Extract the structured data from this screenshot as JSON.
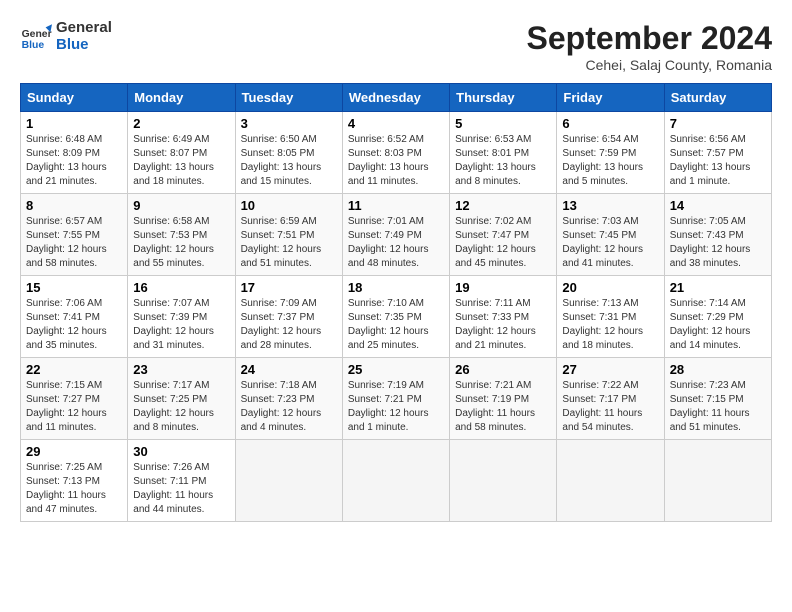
{
  "header": {
    "logo_line1": "General",
    "logo_line2": "Blue",
    "month_title": "September 2024",
    "location": "Cehei, Salaj County, Romania"
  },
  "weekdays": [
    "Sunday",
    "Monday",
    "Tuesday",
    "Wednesday",
    "Thursday",
    "Friday",
    "Saturday"
  ],
  "days": [
    {
      "num": "",
      "info": ""
    },
    {
      "num": "",
      "info": ""
    },
    {
      "num": "",
      "info": ""
    },
    {
      "num": "",
      "info": ""
    },
    {
      "num": "",
      "info": ""
    },
    {
      "num": "",
      "info": ""
    },
    {
      "num": "",
      "info": ""
    },
    {
      "num": "1",
      "info": "Sunrise: 6:48 AM\nSunset: 8:09 PM\nDaylight: 13 hours\nand 21 minutes."
    },
    {
      "num": "2",
      "info": "Sunrise: 6:49 AM\nSunset: 8:07 PM\nDaylight: 13 hours\nand 18 minutes."
    },
    {
      "num": "3",
      "info": "Sunrise: 6:50 AM\nSunset: 8:05 PM\nDaylight: 13 hours\nand 15 minutes."
    },
    {
      "num": "4",
      "info": "Sunrise: 6:52 AM\nSunset: 8:03 PM\nDaylight: 13 hours\nand 11 minutes."
    },
    {
      "num": "5",
      "info": "Sunrise: 6:53 AM\nSunset: 8:01 PM\nDaylight: 13 hours\nand 8 minutes."
    },
    {
      "num": "6",
      "info": "Sunrise: 6:54 AM\nSunset: 7:59 PM\nDaylight: 13 hours\nand 5 minutes."
    },
    {
      "num": "7",
      "info": "Sunrise: 6:56 AM\nSunset: 7:57 PM\nDaylight: 13 hours\nand 1 minute."
    },
    {
      "num": "8",
      "info": "Sunrise: 6:57 AM\nSunset: 7:55 PM\nDaylight: 12 hours\nand 58 minutes."
    },
    {
      "num": "9",
      "info": "Sunrise: 6:58 AM\nSunset: 7:53 PM\nDaylight: 12 hours\nand 55 minutes."
    },
    {
      "num": "10",
      "info": "Sunrise: 6:59 AM\nSunset: 7:51 PM\nDaylight: 12 hours\nand 51 minutes."
    },
    {
      "num": "11",
      "info": "Sunrise: 7:01 AM\nSunset: 7:49 PM\nDaylight: 12 hours\nand 48 minutes."
    },
    {
      "num": "12",
      "info": "Sunrise: 7:02 AM\nSunset: 7:47 PM\nDaylight: 12 hours\nand 45 minutes."
    },
    {
      "num": "13",
      "info": "Sunrise: 7:03 AM\nSunset: 7:45 PM\nDaylight: 12 hours\nand 41 minutes."
    },
    {
      "num": "14",
      "info": "Sunrise: 7:05 AM\nSunset: 7:43 PM\nDaylight: 12 hours\nand 38 minutes."
    },
    {
      "num": "15",
      "info": "Sunrise: 7:06 AM\nSunset: 7:41 PM\nDaylight: 12 hours\nand 35 minutes."
    },
    {
      "num": "16",
      "info": "Sunrise: 7:07 AM\nSunset: 7:39 PM\nDaylight: 12 hours\nand 31 minutes."
    },
    {
      "num": "17",
      "info": "Sunrise: 7:09 AM\nSunset: 7:37 PM\nDaylight: 12 hours\nand 28 minutes."
    },
    {
      "num": "18",
      "info": "Sunrise: 7:10 AM\nSunset: 7:35 PM\nDaylight: 12 hours\nand 25 minutes."
    },
    {
      "num": "19",
      "info": "Sunrise: 7:11 AM\nSunset: 7:33 PM\nDaylight: 12 hours\nand 21 minutes."
    },
    {
      "num": "20",
      "info": "Sunrise: 7:13 AM\nSunset: 7:31 PM\nDaylight: 12 hours\nand 18 minutes."
    },
    {
      "num": "21",
      "info": "Sunrise: 7:14 AM\nSunset: 7:29 PM\nDaylight: 12 hours\nand 14 minutes."
    },
    {
      "num": "22",
      "info": "Sunrise: 7:15 AM\nSunset: 7:27 PM\nDaylight: 12 hours\nand 11 minutes."
    },
    {
      "num": "23",
      "info": "Sunrise: 7:17 AM\nSunset: 7:25 PM\nDaylight: 12 hours\nand 8 minutes."
    },
    {
      "num": "24",
      "info": "Sunrise: 7:18 AM\nSunset: 7:23 PM\nDaylight: 12 hours\nand 4 minutes."
    },
    {
      "num": "25",
      "info": "Sunrise: 7:19 AM\nSunset: 7:21 PM\nDaylight: 12 hours\nand 1 minute."
    },
    {
      "num": "26",
      "info": "Sunrise: 7:21 AM\nSunset: 7:19 PM\nDaylight: 11 hours\nand 58 minutes."
    },
    {
      "num": "27",
      "info": "Sunrise: 7:22 AM\nSunset: 7:17 PM\nDaylight: 11 hours\nand 54 minutes."
    },
    {
      "num": "28",
      "info": "Sunrise: 7:23 AM\nSunset: 7:15 PM\nDaylight: 11 hours\nand 51 minutes."
    },
    {
      "num": "29",
      "info": "Sunrise: 7:25 AM\nSunset: 7:13 PM\nDaylight: 11 hours\nand 47 minutes."
    },
    {
      "num": "30",
      "info": "Sunrise: 7:26 AM\nSunset: 7:11 PM\nDaylight: 11 hours\nand 44 minutes."
    },
    {
      "num": "",
      "info": ""
    },
    {
      "num": "",
      "info": ""
    },
    {
      "num": "",
      "info": ""
    },
    {
      "num": "",
      "info": ""
    },
    {
      "num": "",
      "info": ""
    }
  ]
}
